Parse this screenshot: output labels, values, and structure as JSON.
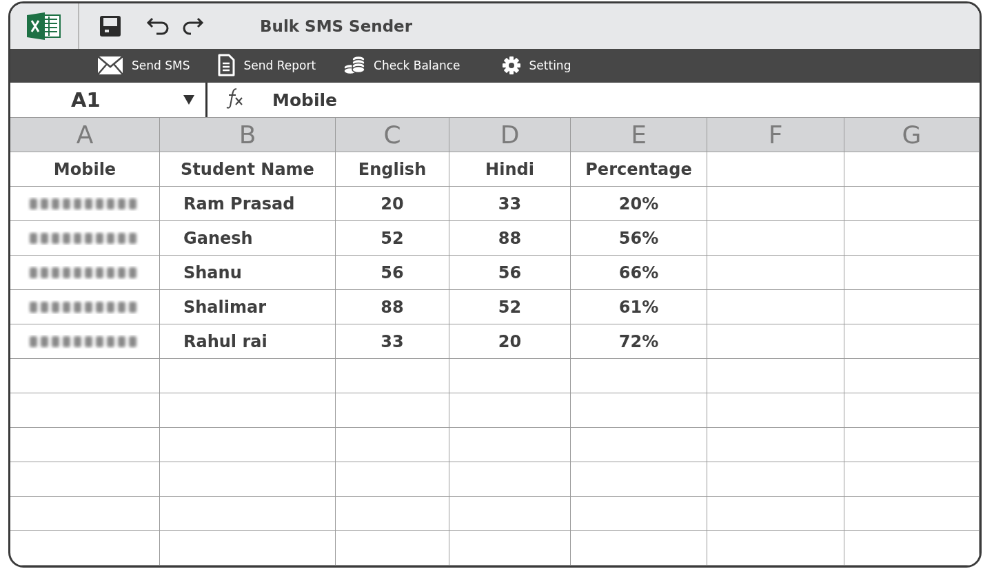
{
  "window": {
    "title": "Bulk SMS Sender"
  },
  "toolbar": [
    {
      "kind": "mail",
      "label": "Send SMS"
    },
    {
      "kind": "document",
      "label": "Send Report"
    },
    {
      "kind": "coins",
      "label": "Check Balance"
    },
    {
      "kind": "gear",
      "label": "Setting"
    }
  ],
  "formula_bar": {
    "cell": "A1",
    "formula": "Mobile"
  },
  "columns": [
    "A",
    "B",
    "C",
    "D",
    "E",
    "F",
    "G"
  ],
  "table": {
    "header": [
      "Mobile",
      "Student Name",
      "English",
      "Hindi",
      "Percentage"
    ],
    "rows": [
      {
        "mobile_blurred": true,
        "name": "Ram Prasad",
        "english": "20",
        "hindi": "33",
        "percentage": "20%"
      },
      {
        "mobile_blurred": true,
        "name": "Ganesh",
        "english": "52",
        "hindi": "88",
        "percentage": "56%"
      },
      {
        "mobile_blurred": true,
        "name": "Shanu",
        "english": "56",
        "hindi": "56",
        "percentage": "66%"
      },
      {
        "mobile_blurred": true,
        "name": "Shalimar",
        "english": "88",
        "hindi": "52",
        "percentage": "61%"
      },
      {
        "mobile_blurred": true,
        "name": "Rahul rai",
        "english": "33",
        "hindi": "20",
        "percentage": "72%"
      }
    ]
  }
}
